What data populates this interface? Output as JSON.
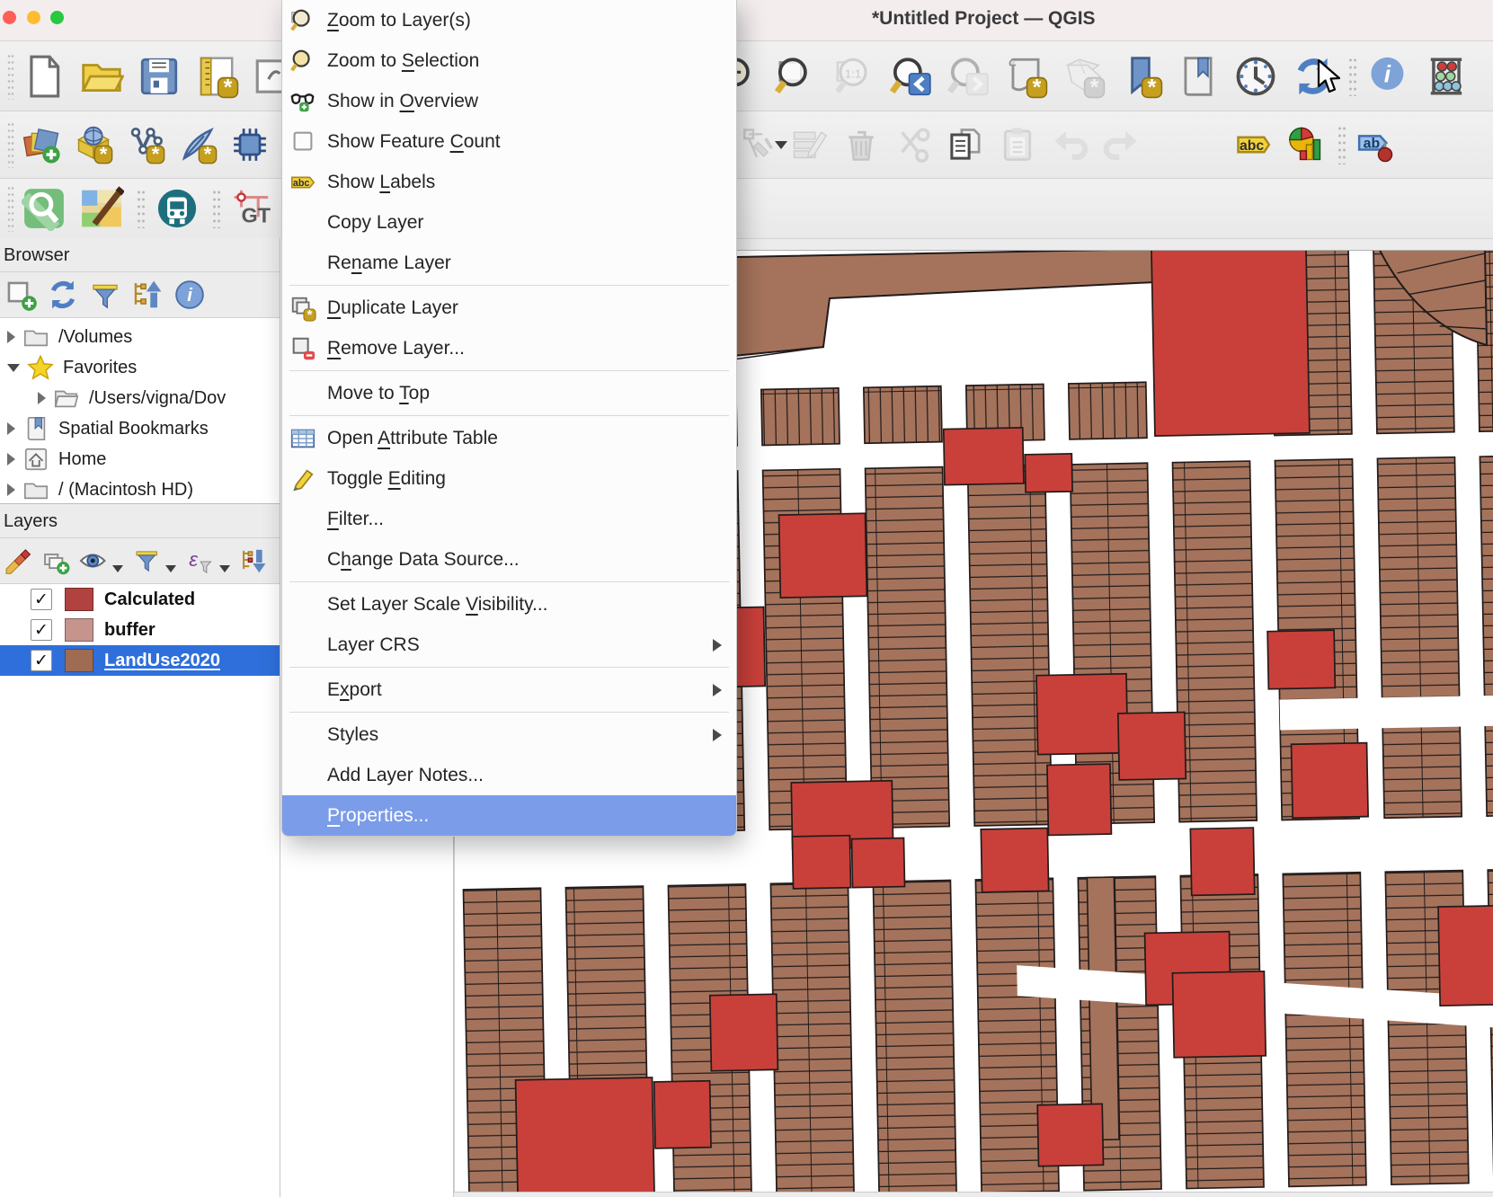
{
  "window": {
    "title": "*Untitled Project — QGIS"
  },
  "titlebar": {
    "traffic_lights": [
      "close",
      "minimize",
      "zoom"
    ]
  },
  "colors": {
    "selection_blue": "#2e6fdb",
    "menu_highlight": "#7b9ce8",
    "traffic_red": "#ff5f57",
    "traffic_yellow": "#febc2e",
    "traffic_green": "#28c840",
    "map_parcel": "#a5735c",
    "map_building": "#c9403a",
    "map_outline": "#221b1a",
    "map_street": "#ffffff"
  },
  "toolbars": {
    "row1_left": [
      {
        "icon": "new-project",
        "name": "new-project-button"
      },
      {
        "icon": "open-project",
        "name": "open-project-button"
      },
      {
        "icon": "save-project",
        "name": "save-project-button"
      },
      {
        "icon": "new-print-layout",
        "name": "new-print-layout-button"
      },
      {
        "icon": "sketchbook",
        "name": "show-layout-manager-button"
      }
    ],
    "row1_right": [
      {
        "icon": "zoom-in",
        "name": "zoom-in-button"
      },
      {
        "icon": "zoom-full",
        "name": "zoom-full-button"
      },
      {
        "icon": "zoom-native",
        "name": "zoom-native-button",
        "disabled": true
      },
      {
        "icon": "zoom-last",
        "name": "zoom-last-button"
      },
      {
        "icon": "zoom-next",
        "name": "zoom-next-button",
        "disabled": true
      },
      {
        "icon": "print-layout-gear",
        "name": "new-print-layout-button-2"
      },
      {
        "icon": "map3d",
        "name": "new-3d-map-view-button",
        "disabled": true
      },
      {
        "icon": "bookmark-new",
        "name": "new-spatial-bookmark-button"
      },
      {
        "icon": "bookmark-show",
        "name": "show-spatial-bookmarks-button"
      },
      {
        "icon": "temporal",
        "name": "temporal-controller-button"
      },
      {
        "icon": "refresh",
        "name": "refresh-map-button"
      },
      {
        "sep": true
      },
      {
        "icon": "identify",
        "name": "identify-features-button"
      },
      {
        "icon": "statistics",
        "name": "statistical-summary-button"
      }
    ],
    "row2_left": [
      {
        "icon": "data-source-manager",
        "name": "data-source-manager-button"
      },
      {
        "icon": "add-vector",
        "name": "add-vector-layer-button"
      },
      {
        "icon": "new-shapefile",
        "name": "new-shapefile-layer-button"
      },
      {
        "icon": "new-scratch",
        "name": "new-scratch-layer-button"
      },
      {
        "icon": "processing-chip",
        "name": "processing-toolbox-button"
      }
    ],
    "row2_right": [
      {
        "icon": "save-edits",
        "name": "save-edits-button",
        "disabled": true
      },
      {
        "icon": "vertex-tool",
        "name": "vertex-tool-button",
        "disabled": true,
        "caret": true
      },
      {
        "icon": "multiedit",
        "name": "modify-attributes-button",
        "disabled": true
      },
      {
        "icon": "delete-selected",
        "name": "delete-selected-button",
        "disabled": true
      },
      {
        "icon": "cut-features",
        "name": "cut-features-button",
        "disabled": true
      },
      {
        "icon": "copy-features",
        "name": "copy-features-button"
      },
      {
        "icon": "paste-features",
        "name": "paste-features-button",
        "disabled": true
      },
      {
        "icon": "undo",
        "name": "undo-button",
        "disabled": true
      },
      {
        "icon": "redo",
        "name": "redo-button",
        "disabled": true
      }
    ],
    "row2_far": [
      {
        "icon": "label-abc",
        "name": "layer-labeling-button"
      },
      {
        "icon": "diagrams",
        "name": "layer-diagram-button"
      },
      {
        "sep": true
      },
      {
        "icon": "map-tips",
        "name": "map-tips-button"
      }
    ],
    "row3_left": [
      {
        "icon": "plugin-zoom",
        "name": "plugin-search-button"
      },
      {
        "icon": "plugin-osm",
        "name": "plugin-osm-edit-button"
      },
      {
        "sep": true
      },
      {
        "icon": "plugin-bus",
        "name": "plugin-transit-button"
      },
      {
        "sep": true
      },
      {
        "icon": "plugin-gtfs",
        "name": "plugin-gtfs-button"
      }
    ]
  },
  "browser_panel": {
    "title": "Browser",
    "toolbar": [
      {
        "icon": "p-add-layer",
        "name": "browser-add-selected-layers-button"
      },
      {
        "icon": "refresh",
        "name": "browser-refresh-button"
      },
      {
        "icon": "p-filter",
        "name": "browser-filter-button"
      },
      {
        "icon": "p-collapse",
        "name": "browser-collapse-all-button"
      },
      {
        "icon": "p-info",
        "name": "browser-properties-button"
      }
    ],
    "tree": [
      {
        "label": "/Volumes",
        "icon": "t-folder",
        "expander": "right",
        "indent": 0
      },
      {
        "label": "Favorites",
        "icon": "t-star",
        "expander": "down",
        "indent": 0
      },
      {
        "label": "/Users/vigna/Dov",
        "icon": "t-folder-open",
        "expander": "right",
        "indent": 1
      },
      {
        "label": "Spatial Bookmarks",
        "icon": "t-bookmarks",
        "expander": "right",
        "indent": 0
      },
      {
        "label": "Home",
        "icon": "t-home",
        "expander": "right",
        "indent": 0
      },
      {
        "label": "/ (Macintosh HD)",
        "icon": "t-folder",
        "expander": "right",
        "indent": 0
      }
    ]
  },
  "layers_panel": {
    "title": "Layers",
    "toolbar": [
      {
        "icon": "p-style",
        "name": "layer-styling-button"
      },
      {
        "icon": "p-add-group",
        "name": "add-group-button"
      },
      {
        "icon": "p-eye",
        "name": "manage-map-themes-button",
        "caret": true
      },
      {
        "icon": "p-funnel",
        "name": "filter-legend-button",
        "caret": true
      },
      {
        "icon": "p-expression",
        "name": "filter-expression-button",
        "caret": true
      },
      {
        "icon": "p-expand-tree",
        "name": "expand-collapse-button"
      }
    ],
    "layers": [
      {
        "label": "Calculated",
        "checked": true,
        "swatch": "#b2423f",
        "selected": false
      },
      {
        "label": "buffer",
        "checked": true,
        "swatch": "#c6948d",
        "selected": false
      },
      {
        "label": "LandUse2020",
        "checked": true,
        "swatch": "#a06b53",
        "selected": true
      }
    ]
  },
  "context_menu": {
    "items": [
      {
        "label": "Zoom to Layer(s)",
        "ul": 0,
        "icon": "m-zoom-layers"
      },
      {
        "label": "Zoom to Selection",
        "ul": 8,
        "icon": "m-zoom-selection"
      },
      {
        "label": "Show in Overview",
        "ul": 8,
        "icon": "m-overview"
      },
      {
        "label": "Show Feature Count",
        "ul": 13,
        "icon": "m-count"
      },
      {
        "label": "Show Labels",
        "ul": 5,
        "icon": "m-labels"
      },
      {
        "label": "Copy Layer",
        "ul": -1,
        "icon": null
      },
      {
        "label": "Rename Layer",
        "ul": 2,
        "icon": null,
        "sep_after": true
      },
      {
        "label": "Duplicate Layer",
        "ul": 0,
        "icon": "m-duplicate"
      },
      {
        "label": "Remove Layer...",
        "ul": 0,
        "icon": "m-remove",
        "sep_after": true
      },
      {
        "label": "Move to Top",
        "ul": 8,
        "icon": null,
        "sep_after": true
      },
      {
        "label": "Open Attribute Table",
        "ul": 5,
        "icon": "m-attr-table"
      },
      {
        "label": "Toggle Editing",
        "ul": 7,
        "icon": "m-toggle-edit"
      },
      {
        "label": "Filter...",
        "ul": 0,
        "icon": null
      },
      {
        "label": "Change Data Source...",
        "ul": 1,
        "icon": null,
        "sep_after": true
      },
      {
        "label": "Set Layer Scale Visibility...",
        "ul": 16,
        "icon": null
      },
      {
        "label": "Layer CRS",
        "ul": -1,
        "icon": null,
        "submenu": true,
        "sep_after": true
      },
      {
        "label": "Export",
        "ul": 1,
        "icon": null,
        "submenu": true,
        "sep_after": true
      },
      {
        "label": "Styles",
        "ul": -1,
        "icon": null,
        "submenu": true
      },
      {
        "label": "Add Layer Notes...",
        "ul": -1,
        "icon": null
      },
      {
        "label": "Properties...",
        "ul": 0,
        "icon": null,
        "highlighted": true
      }
    ]
  },
  "cursor": {
    "type": "arrow-cursor"
  }
}
